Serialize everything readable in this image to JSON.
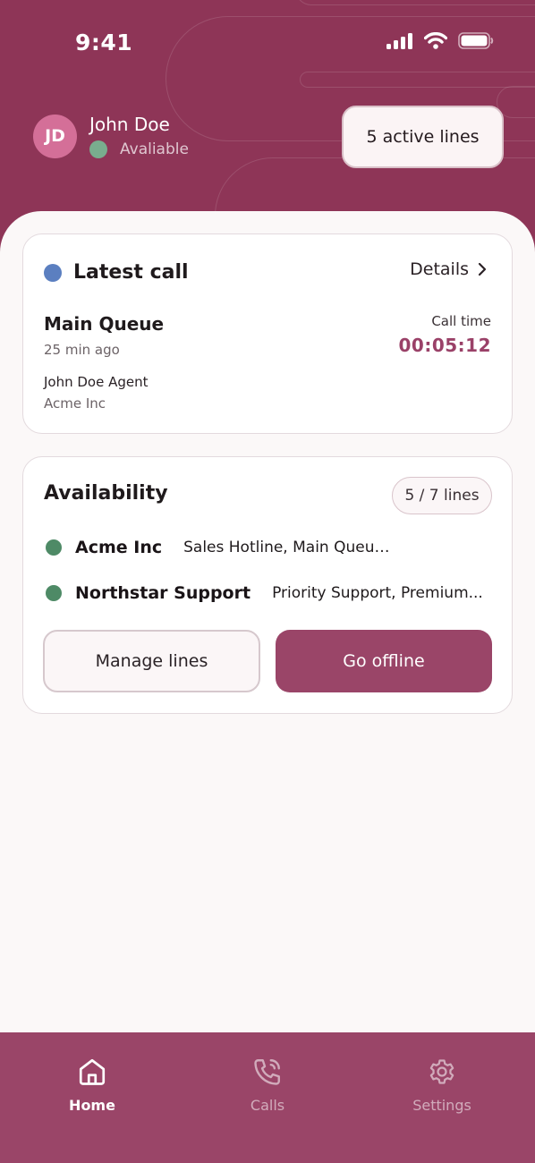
{
  "status_bar": {
    "time": "9:41"
  },
  "profile": {
    "initials": "JD",
    "name": "John Doe",
    "status": "Avaliable"
  },
  "header": {
    "active_lines_label": "5 active lines"
  },
  "latest_call": {
    "title": "Latest call",
    "details_label": "Details",
    "queue_name": "Main Queue",
    "time_ago": "25 min ago",
    "agent_name": "John Doe Agent",
    "agent_company": "Acme Inc",
    "call_time_label": "Call time",
    "call_time_value": "00:05:12"
  },
  "availability": {
    "title": "Availability",
    "lines_badge": "5 / 7 lines",
    "orgs": [
      {
        "name": "Acme Inc",
        "lines": "Sales Hotline, Main Queue, Overflow"
      },
      {
        "name": "Northstar Support",
        "lines": "Priority Support, Premium..."
      }
    ],
    "manage_label": "Manage lines",
    "offline_label": "Go offline"
  },
  "tabbar": {
    "tabs": [
      {
        "label": "Home",
        "icon": "home-icon",
        "active": true
      },
      {
        "label": "Calls",
        "icon": "phone-icon",
        "active": false
      },
      {
        "label": "Settings",
        "icon": "gear-icon",
        "active": false
      }
    ]
  },
  "colors": {
    "brand": "#8e3557",
    "accent": "#9a4568",
    "status_available": "#79ad8e",
    "call_dot": "#5b7fc0",
    "org_online": "#4e8a66"
  }
}
